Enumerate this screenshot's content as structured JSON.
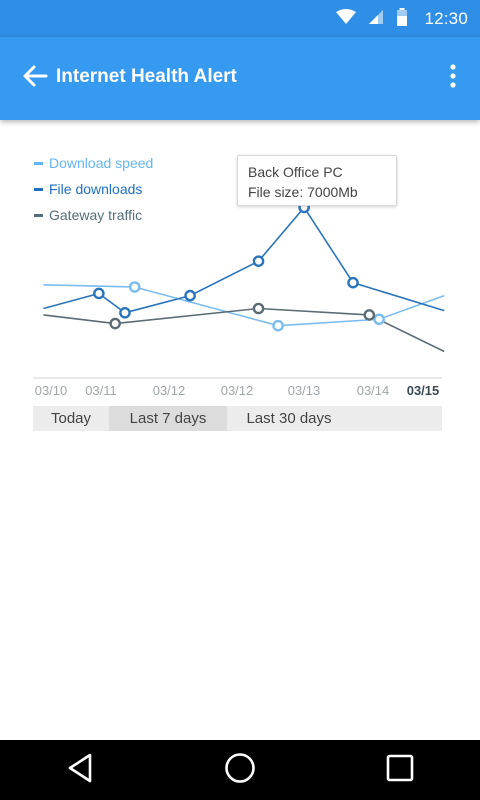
{
  "status_bar": {
    "time": "12:30",
    "icons": [
      "wifi-icon",
      "signal-icon",
      "battery-icon"
    ]
  },
  "app_bar": {
    "title": "Internet Health Alert",
    "back_icon": "arrow-left-icon",
    "menu_icon": "more-vert-icon"
  },
  "legend": [
    {
      "label": "Download speed",
      "color": "#64b5f6"
    },
    {
      "label": "File downloads",
      "color": "#1e6fc0"
    },
    {
      "label": "Gateway traffic",
      "color": "#546e7a"
    }
  ],
  "tooltip": {
    "line1": "Back Office PC",
    "line2": "File size: 7000Mb"
  },
  "chart_data": {
    "type": "line",
    "categories": [
      "03/10",
      "03/11",
      "03/12",
      "03/12",
      "03/13",
      "03/14",
      "03/15"
    ],
    "highlighted_category": "03/15",
    "grid": false,
    "legend_position": "top-left",
    "y_axis_labels": false,
    "series": [
      {
        "name": "Download speed",
        "color": "#7bbcef",
        "x": [
          0,
          0.5,
          1,
          1.5,
          2,
          2.5,
          3,
          3.5,
          4,
          4.5,
          5,
          5.5,
          6
        ],
        "values": [
          null,
          null,
          40,
          null,
          null,
          null,
          22,
          null,
          null,
          null,
          25,
          null,
          null
        ],
        "line": [
          [
            -0.1,
            41
          ],
          [
            1.3,
            40
          ],
          [
            3.5,
            22
          ],
          [
            5.05,
            25
          ],
          [
            6.05,
            36
          ]
        ]
      },
      {
        "name": "File downloads",
        "color": "#2a74bc",
        "line": [
          [
            -0.1,
            30
          ],
          [
            0.75,
            37
          ],
          [
            1.15,
            28
          ],
          [
            2.15,
            36
          ],
          [
            3.2,
            52
          ],
          [
            3.9,
            77
          ],
          [
            4.65,
            42
          ],
          [
            6.05,
            29
          ]
        ],
        "markers": [
          [
            0.75,
            37
          ],
          [
            1.15,
            28
          ],
          [
            2.15,
            36
          ],
          [
            3.2,
            52
          ],
          [
            3.9,
            77
          ],
          [
            4.65,
            42
          ]
        ]
      },
      {
        "name": "Gateway traffic",
        "color": "#5c6b73",
        "line": [
          [
            -0.1,
            27
          ],
          [
            1.0,
            23
          ],
          [
            3.2,
            30
          ],
          [
            4.9,
            27
          ],
          [
            6.05,
            10
          ]
        ],
        "markers": [
          [
            1.0,
            23
          ],
          [
            3.2,
            30
          ],
          [
            4.9,
            27
          ]
        ]
      }
    ],
    "download_markers": [
      [
        1.3,
        40
      ],
      [
        3.5,
        22
      ],
      [
        5.05,
        25
      ]
    ],
    "tooltip_point": [
      3.9,
      77
    ],
    "ylim": [
      0,
      100
    ]
  },
  "range_tabs": [
    {
      "label": "Today",
      "active": false
    },
    {
      "label": "Last 7 days",
      "active": true
    },
    {
      "label": "Last 30 days",
      "active": false
    }
  ],
  "nav_bar": {
    "icons": [
      "back-triangle-icon",
      "home-circle-icon",
      "recents-square-icon"
    ]
  }
}
